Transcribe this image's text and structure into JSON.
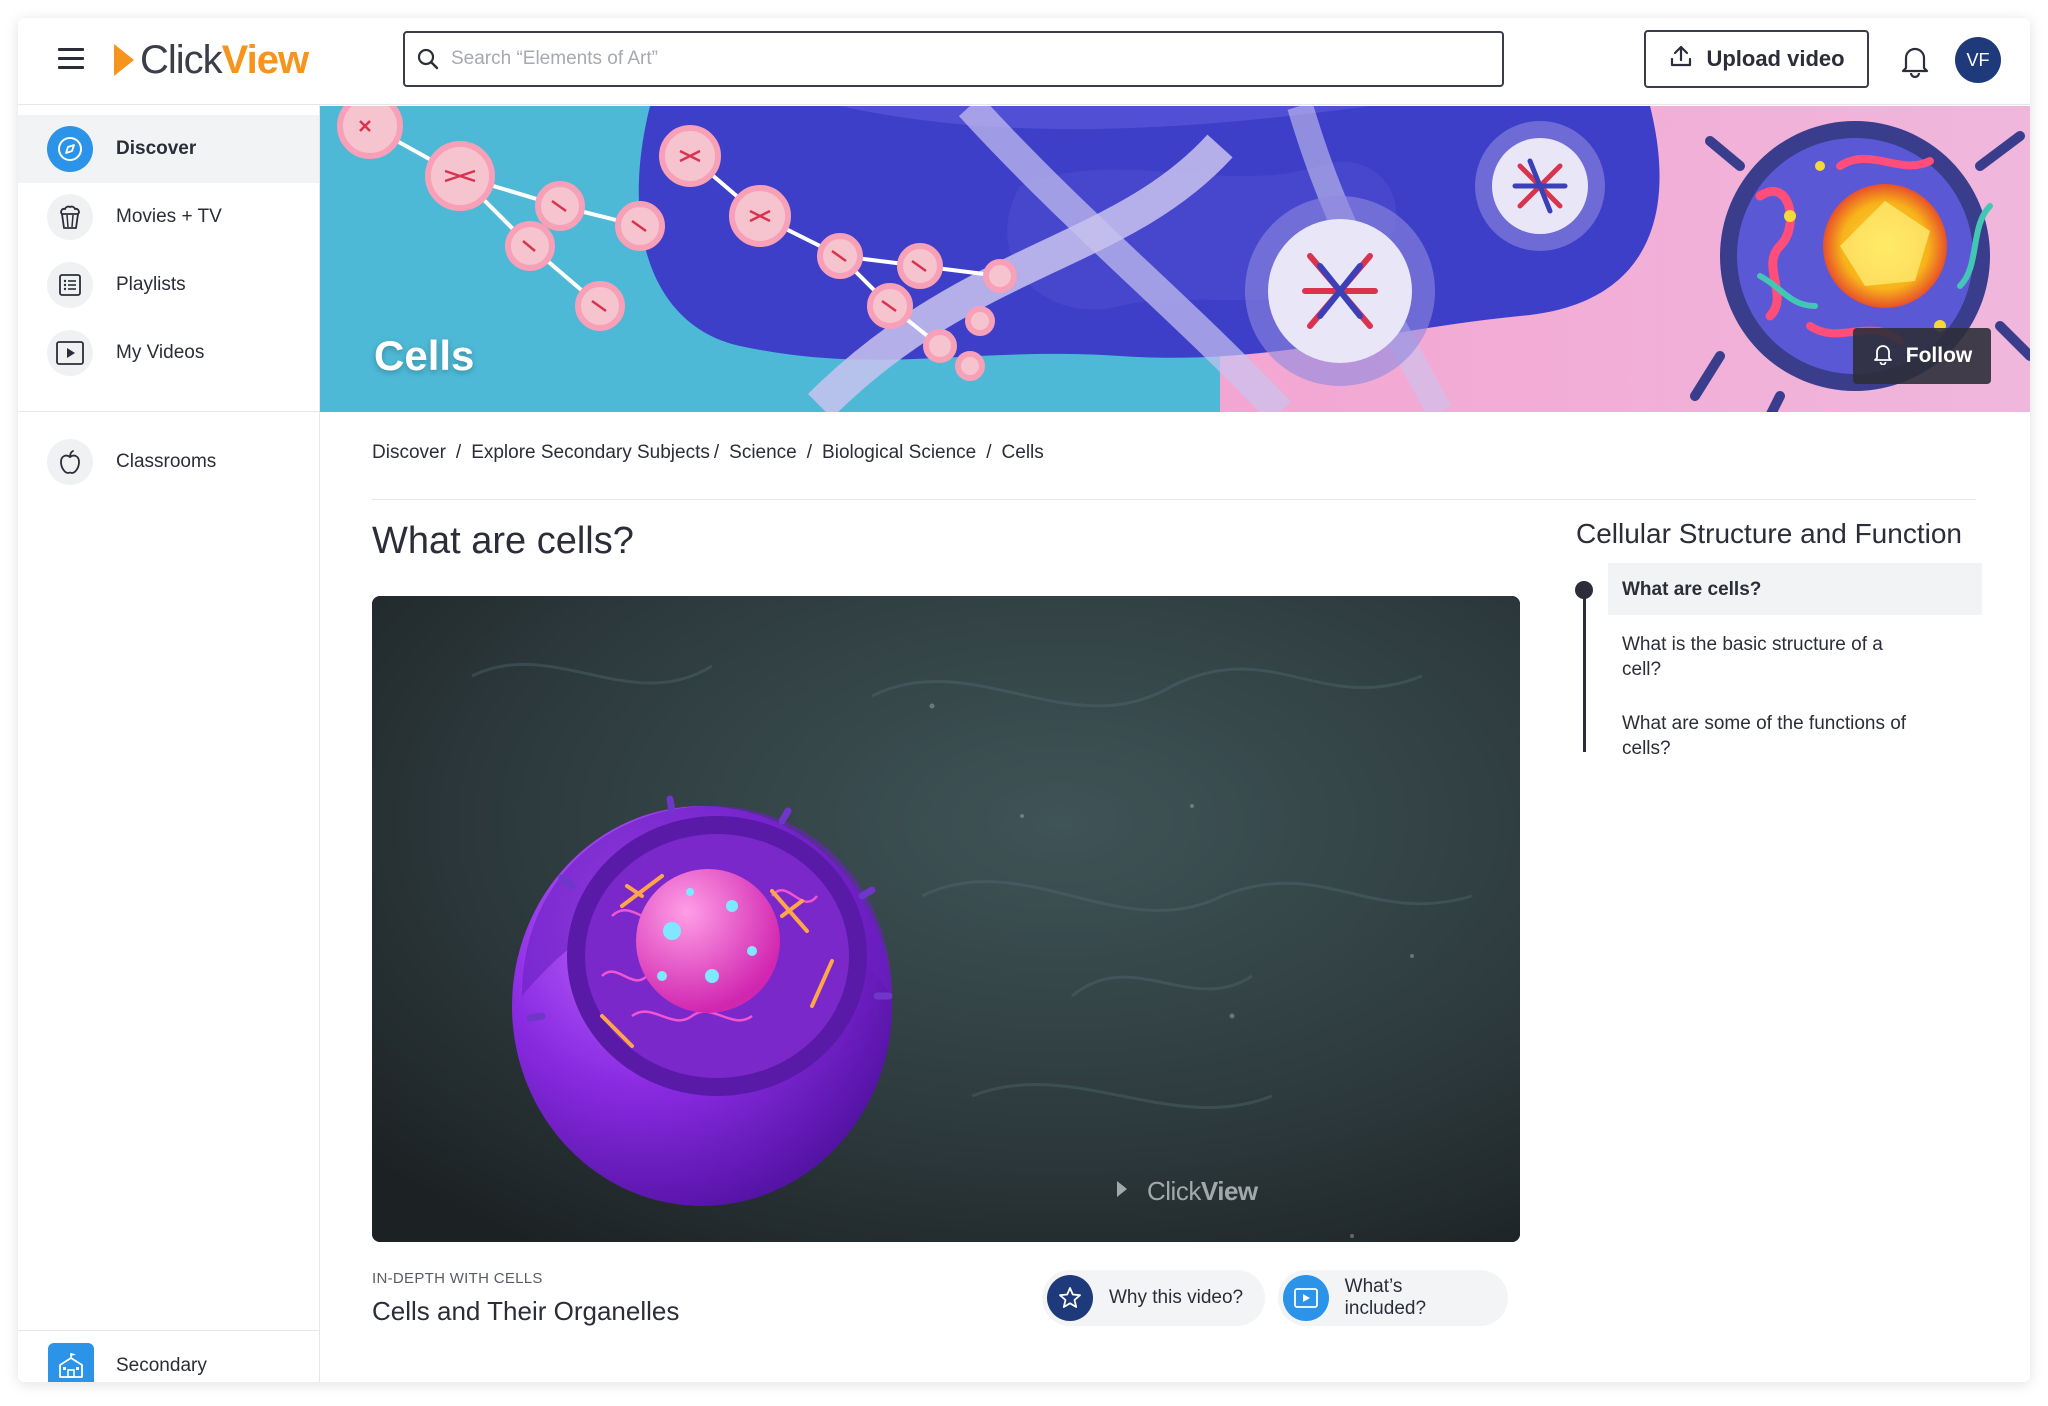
{
  "app": {
    "logo_part1": "Click",
    "logo_part2": "View",
    "brand_color": "#f7941d"
  },
  "header": {
    "search_placeholder": "Search “Elements of Art”",
    "upload_label": "Upload video",
    "avatar_initials": "VF"
  },
  "sidebar": {
    "items": [
      {
        "label": "Discover",
        "icon": "compass-icon",
        "active": true
      },
      {
        "label": "Movies + TV",
        "icon": "popcorn-icon"
      },
      {
        "label": "Playlists",
        "icon": "list-icon"
      },
      {
        "label": "My Videos",
        "icon": "play-box-icon"
      }
    ],
    "classrooms_label": "Classrooms",
    "footer_label": "Secondary"
  },
  "banner": {
    "title": "Cells",
    "follow_label": "Follow"
  },
  "breadcrumb": [
    "Discover",
    "Explore Secondary Subjects",
    "Science",
    "Biological Science",
    "Cells"
  ],
  "main": {
    "title": "What are cells?",
    "video_watermark_1": "Click",
    "video_watermark_2": "View",
    "series_label": "IN-DEPTH WITH CELLS",
    "video_title": "Cells and Their Organelles",
    "why_label": "Why this video?",
    "included_label": "What’s included?"
  },
  "panel": {
    "title": "Cellular Structure and Function",
    "items": [
      {
        "label": "What are cells?",
        "active": true
      },
      {
        "label": "What is the basic structure of a cell?"
      },
      {
        "label": "What are some of the functions of cells?"
      }
    ]
  },
  "colors": {
    "accent_blue": "#2b93e8",
    "avatar_navy": "#1f3a7a",
    "text_dark": "#2b2d38"
  }
}
